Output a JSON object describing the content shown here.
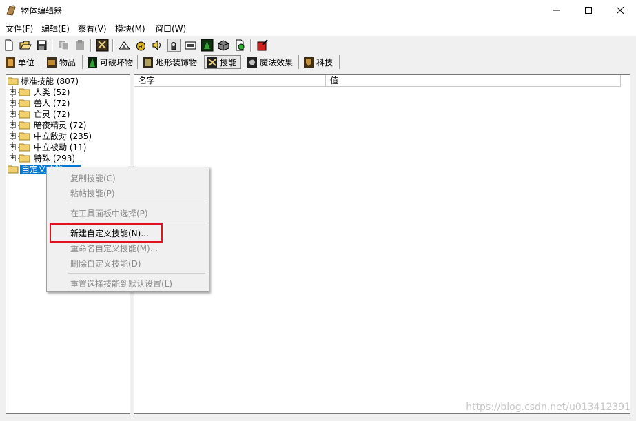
{
  "window": {
    "title": "物体编辑器",
    "controls": {
      "minimize": "—",
      "maximize": "☐",
      "close": "✕"
    }
  },
  "menubar": {
    "items": [
      "文件(F)",
      "编辑(E)",
      "察看(V)",
      "模块(M)",
      "窗口(W)"
    ]
  },
  "toolbar": {
    "icons": [
      "new-file-icon",
      "open-folder-icon",
      "save-icon",
      "copy-icon",
      "paste-icon",
      "unit-toolbar-icon",
      "terrain-icon",
      "item-bag-icon",
      "sound-icon",
      "ability-hand-icon",
      "camera-icon",
      "doodad-icon",
      "crate-icon",
      "import-icon",
      "test-map-icon"
    ]
  },
  "tabs": [
    {
      "label": "单位",
      "icon": "unit-tab-icon"
    },
    {
      "label": "物品",
      "icon": "item-tab-icon"
    },
    {
      "label": "可破坏物",
      "icon": "destructible-tab-icon"
    },
    {
      "label": "地形装饰物",
      "icon": "doodad-tab-icon"
    },
    {
      "label": "技能",
      "icon": "ability-tab-icon"
    },
    {
      "label": "魔法效果",
      "icon": "buff-tab-icon"
    },
    {
      "label": "科技",
      "icon": "upgrade-tab-icon"
    }
  ],
  "tree": {
    "root": "标准技能 (807)",
    "children": [
      "人类 (52)",
      "兽人 (72)",
      "亡灵 (72)",
      "暗夜精灵 (72)",
      "中立敌对 (235)",
      "中立被动 (11)",
      "特殊 (293)"
    ],
    "custom": "自定义技能"
  },
  "table": {
    "columns": [
      "名字",
      "值"
    ]
  },
  "context_menu": {
    "copy": "复制技能(C)",
    "paste": "粘帖技能(P)",
    "select_palette": "在工具面板中选择(P)",
    "new_custom": "新建自定义技能(N)...",
    "rename": "重命名自定义技能(M)...",
    "delete": "删除自定义技能(D)",
    "reset": "重置选择技能到默认设置(L)"
  },
  "watermark": "https://blog.csdn.net/u013412391",
  "colors": {
    "highlight_box": "#e0141e",
    "selection": "#0078d7",
    "disabled_text": "#8a8a8a"
  }
}
